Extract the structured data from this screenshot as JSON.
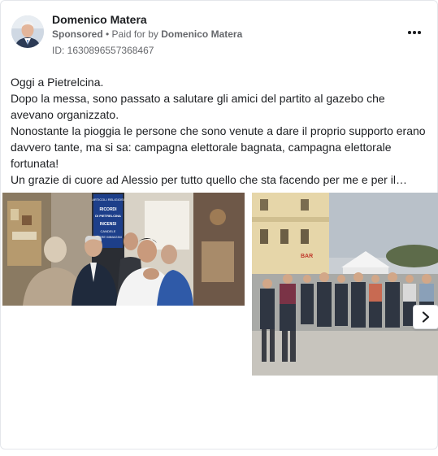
{
  "post": {
    "author": "Domenico Matera",
    "sponsored_label": "Sponsored",
    "separator": " • ",
    "paid_for_prefix": "Paid for by ",
    "paid_for_by": "Domenico Matera",
    "ad_id": "ID: 1630896557368467",
    "text_lines": [
      "Oggi a Pietrelcina.",
      "Dopo la messa, sono passato a salutare gli amici del partito al gazebo che avevano organizzato.",
      "Nonostante la pioggia le persone che sono venute a dare il proprio supporto erano davvero tante, ma si sa: campagna elettorale bagnata, campagna elettorale fortunata!",
      "Un grazie di cuore ad Alessio per tutto quello che sta facendo per me e per il…"
    ]
  },
  "images": {
    "first_sign_lines": [
      "ARTICOLI RELIGIOSI",
      "RICORDI",
      "DI PIETRELCINA",
      "INCENSI",
      "CANDELE",
      "SACRE IMMAGINI"
    ],
    "second_sign_text": "BAR"
  },
  "icons": {
    "more": "more-horizontal-icon",
    "next": "chevron-right-icon"
  }
}
